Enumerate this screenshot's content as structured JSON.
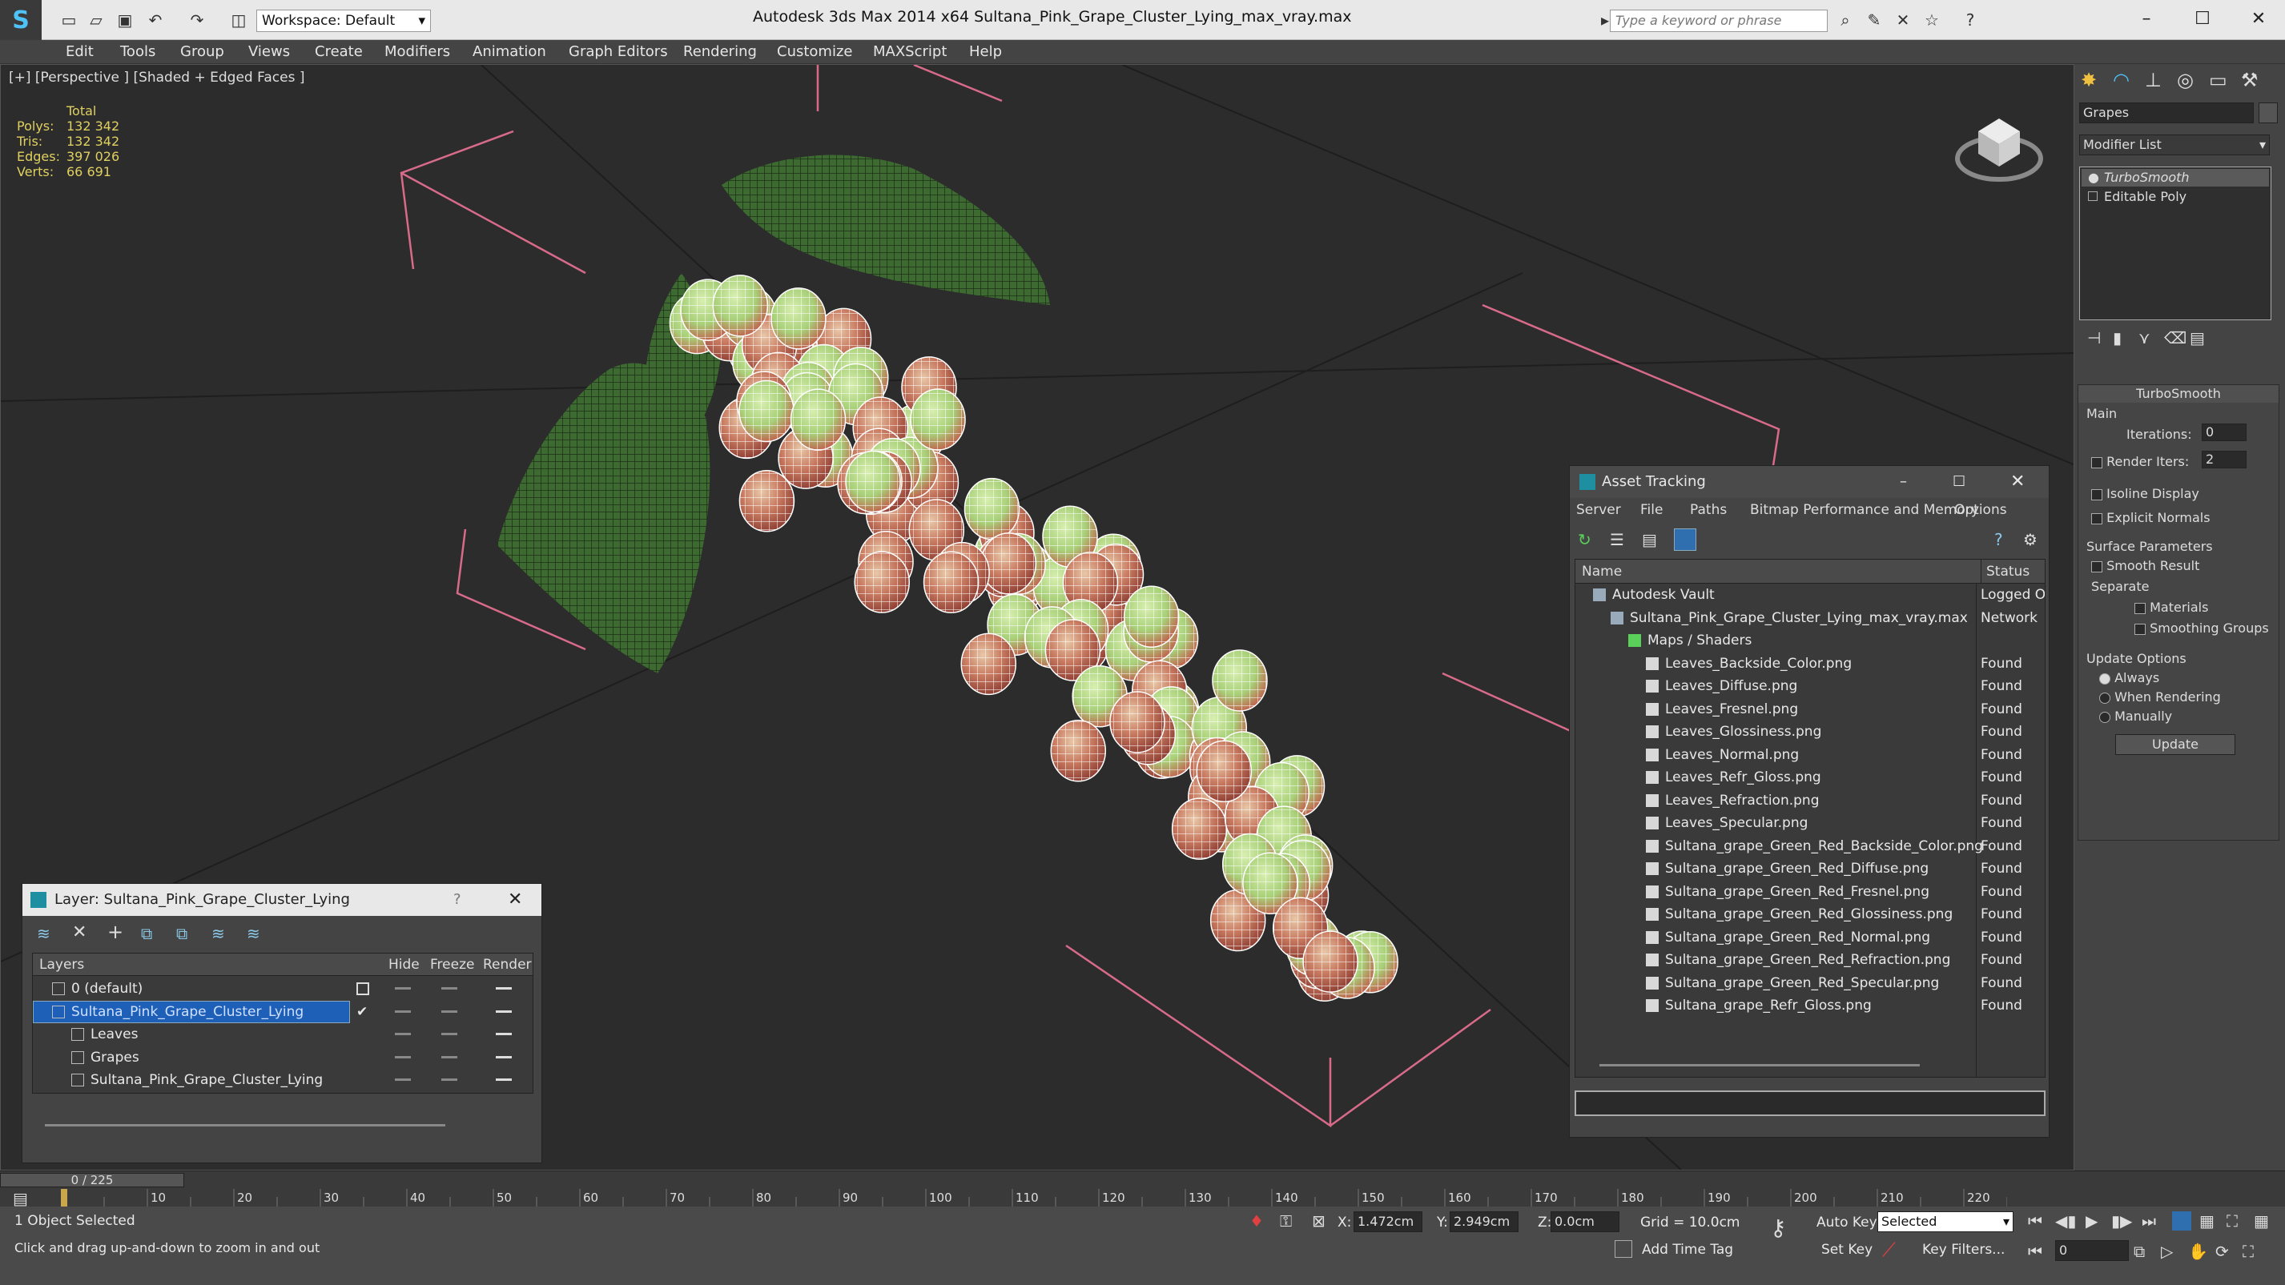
{
  "titlebar": {
    "workspace": "Workspace: Default",
    "app_title": "Autodesk 3ds Max  2014 x64     Sultana_Pink_Grape_Cluster_Lying_max_vray.max",
    "search_placeholder": "Type a keyword or phrase"
  },
  "menu": [
    "Edit",
    "Tools",
    "Group",
    "Views",
    "Create",
    "Modifiers",
    "Animation",
    "Graph Editors",
    "Rendering",
    "Customize",
    "MAXScript",
    "Help"
  ],
  "viewport": {
    "label": "[+] [Perspective ] [Shaded + Edged Faces ]",
    "stats": {
      "header": "Total",
      "rows": [
        {
          "k": "Polys:",
          "v": "132 342"
        },
        {
          "k": "Tris:",
          "v": "132 342"
        },
        {
          "k": "Edges:",
          "v": "397 026"
        },
        {
          "k": "Verts:",
          "v": "66 691"
        }
      ]
    }
  },
  "command_panel": {
    "object_name": "Grapes",
    "modifier_list": "Modifier List",
    "stack": [
      "TurboSmooth",
      "Editable Poly"
    ],
    "rollout_title": "TurboSmooth",
    "main_label": "Main",
    "iterations_label": "Iterations:",
    "iterations": "0",
    "render_iters_label": "Render Iters:",
    "render_iters": "2",
    "isoline": "Isoline Display",
    "explicit": "Explicit Normals",
    "surface_params": "Surface Parameters",
    "smooth_result": "Smooth Result",
    "separate": "Separate",
    "materials": "Materials",
    "smoothing_groups": "Smoothing Groups",
    "update_options": "Update Options",
    "always": "Always",
    "when_rendering": "When Rendering",
    "manually": "Manually",
    "update_btn": "Update"
  },
  "asset_tracking": {
    "title": "Asset Tracking",
    "menu": [
      "Server",
      "File",
      "Paths",
      "Bitmap Performance and Memory",
      "Options"
    ],
    "col_name": "Name",
    "col_status": "Status",
    "rows": [
      {
        "name": "Autodesk Vault",
        "status": "Logged O",
        "indent": 1
      },
      {
        "name": "Sultana_Pink_Grape_Cluster_Lying_max_vray.max",
        "status": "Network",
        "indent": 2
      },
      {
        "name": "Maps / Shaders",
        "status": "",
        "indent": 3
      },
      {
        "name": "Leaves_Backside_Color.png",
        "status": "Found",
        "indent": 4
      },
      {
        "name": "Leaves_Diffuse.png",
        "status": "Found",
        "indent": 4
      },
      {
        "name": "Leaves_Fresnel.png",
        "status": "Found",
        "indent": 4
      },
      {
        "name": "Leaves_Glossiness.png",
        "status": "Found",
        "indent": 4
      },
      {
        "name": "Leaves_Normal.png",
        "status": "Found",
        "indent": 4
      },
      {
        "name": "Leaves_Refr_Gloss.png",
        "status": "Found",
        "indent": 4
      },
      {
        "name": "Leaves_Refraction.png",
        "status": "Found",
        "indent": 4
      },
      {
        "name": "Leaves_Specular.png",
        "status": "Found",
        "indent": 4
      },
      {
        "name": "Sultana_grape_Green_Red_Backside_Color.png",
        "status": "Found",
        "indent": 4
      },
      {
        "name": "Sultana_grape_Green_Red_Diffuse.png",
        "status": "Found",
        "indent": 4
      },
      {
        "name": "Sultana_grape_Green_Red_Fresnel.png",
        "status": "Found",
        "indent": 4
      },
      {
        "name": "Sultana_grape_Green_Red_Glossiness.png",
        "status": "Found",
        "indent": 4
      },
      {
        "name": "Sultana_grape_Green_Red_Normal.png",
        "status": "Found",
        "indent": 4
      },
      {
        "name": "Sultana_grape_Green_Red_Refraction.png",
        "status": "Found",
        "indent": 4
      },
      {
        "name": "Sultana_grape_Green_Red_Specular.png",
        "status": "Found",
        "indent": 4
      },
      {
        "name": "Sultana_grape_Refr_Gloss.png",
        "status": "Found",
        "indent": 4
      }
    ]
  },
  "layer_window": {
    "title": "Layer: Sultana_Pink_Grape_Cluster_Lying",
    "help": "?",
    "col_layers": "Layers",
    "col_hide": "Hide",
    "col_freeze": "Freeze",
    "col_render": "Render",
    "rows": [
      {
        "name": "0 (default)",
        "indent": 1,
        "selected": false
      },
      {
        "name": "Sultana_Pink_Grape_Cluster_Lying",
        "indent": 1,
        "selected": true
      },
      {
        "name": "Leaves",
        "indent": 2,
        "selected": false
      },
      {
        "name": "Grapes",
        "indent": 2,
        "selected": false
      },
      {
        "name": "Sultana_Pink_Grape_Cluster_Lying",
        "indent": 2,
        "selected": false
      }
    ]
  },
  "timeline": {
    "frame": "0 / 225",
    "ticks": [
      "10",
      "20",
      "30",
      "40",
      "50",
      "60",
      "70",
      "80",
      "90",
      "100",
      "110",
      "120",
      "130",
      "140",
      "150",
      "160",
      "170",
      "180",
      "190",
      "200",
      "210",
      "220"
    ]
  },
  "status": {
    "selected": "1 Object Selected",
    "prompt": "Click and drag up-and-down to zoom in and out",
    "x_label": "X:",
    "x": "1.472cm",
    "y_label": "Y:",
    "y": "2.949cm",
    "z_label": "Z:",
    "z": "0.0cm",
    "grid": "Grid = 10.0cm",
    "auto_key": "Auto Key",
    "selected_dd": "Selected",
    "set_key": "Set Key",
    "key_filters": "Key Filters...",
    "add_time_tag": "Add Time Tag",
    "frame_field": "0"
  }
}
